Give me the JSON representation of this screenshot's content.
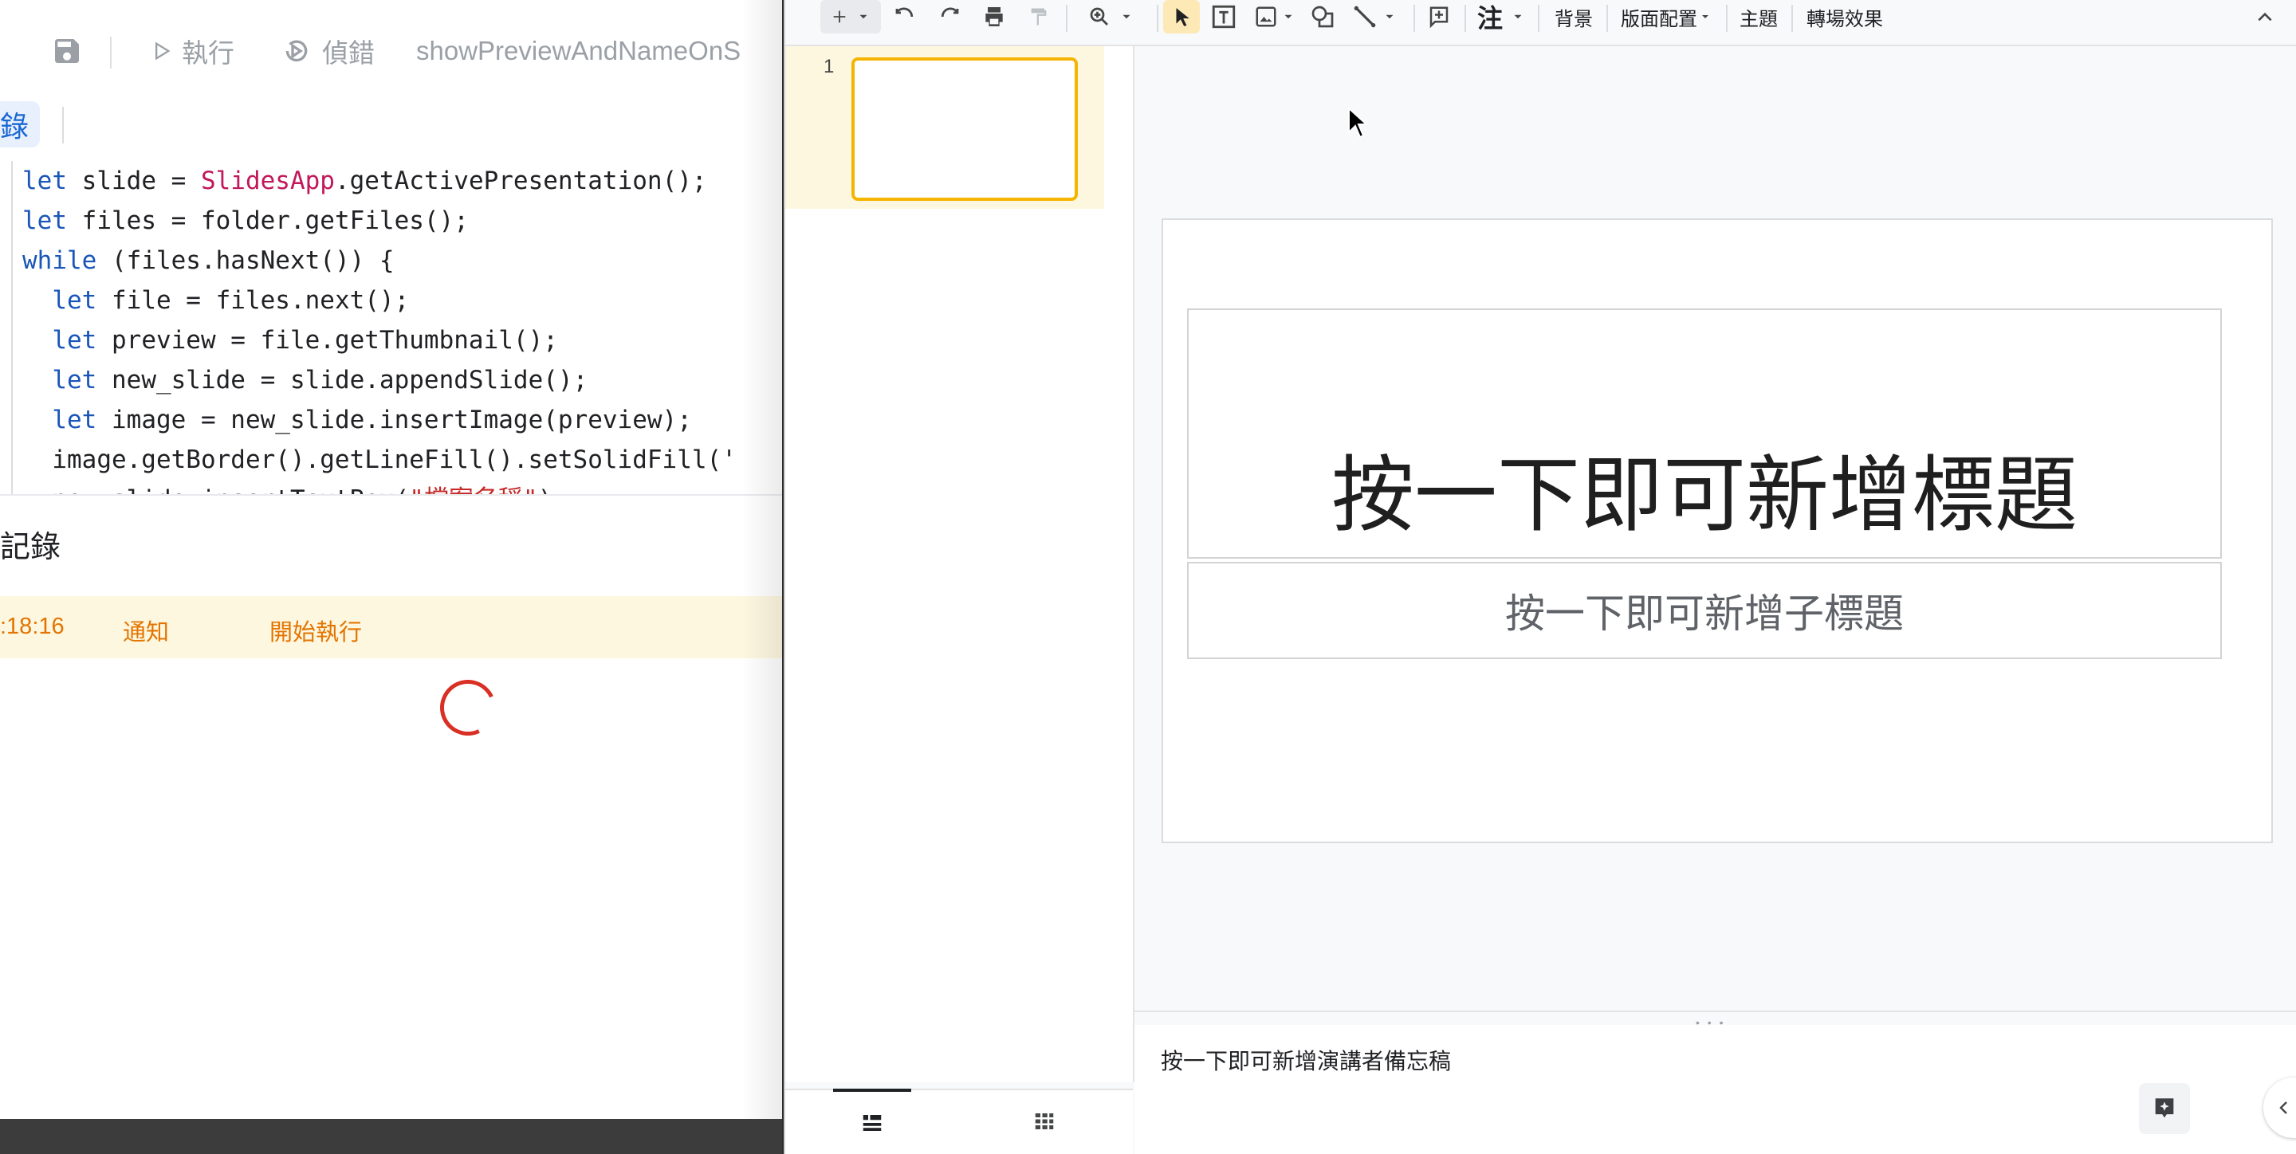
{
  "script_editor": {
    "toolbar": {
      "run_label": "執行",
      "debug_label": "偵錯",
      "function_name": "showPreviewAndNameOnS"
    },
    "tabs": {
      "logs_chip_label": "錄"
    },
    "code_lines": [
      [
        {
          "t": "let",
          "c": "kw"
        },
        {
          "t": " slide = "
        },
        {
          "t": "SlidesApp",
          "c": "cls"
        },
        {
          "t": ".getActivePresentation();"
        }
      ],
      [
        {
          "t": "let",
          "c": "kw"
        },
        {
          "t": " files = folder.getFiles();"
        }
      ],
      [
        {
          "t": "while",
          "c": "kw"
        },
        {
          "t": " (files.hasNext()) {"
        }
      ],
      [
        {
          "t": "  "
        },
        {
          "t": "let",
          "c": "kw"
        },
        {
          "t": " file = files.next();"
        }
      ],
      [
        {
          "t": "  "
        },
        {
          "t": "let",
          "c": "kw"
        },
        {
          "t": " preview = file.getThumbnail();"
        }
      ],
      [
        {
          "t": "  "
        },
        {
          "t": "let",
          "c": "kw"
        },
        {
          "t": " new_slide = slide.appendSlide();"
        }
      ],
      [
        {
          "t": "  "
        },
        {
          "t": "let",
          "c": "kw"
        },
        {
          "t": " image = new_slide.insertImage(preview);"
        }
      ],
      [
        {
          "t": "  image.getBorder().getLineFill().setSolidFill('"
        }
      ],
      [
        {
          "t": "  new_slide.insertTextBox("
        },
        {
          "t": "\"檔案名稱\"",
          "c": "str"
        },
        {
          "t": ");"
        }
      ]
    ],
    "execution_log": {
      "title": "記錄",
      "rows": [
        {
          "time": ":18:16",
          "level": "通知",
          "message": "開始執行"
        }
      ]
    }
  },
  "slides_app": {
    "toolbar": {
      "background_label": "背景",
      "layout_label": "版面配置",
      "theme_label": "主題",
      "transition_label": "轉場效果",
      "comment_label": "注"
    },
    "filmstrip": {
      "slides": [
        {
          "number": "1"
        }
      ]
    },
    "slide": {
      "title_placeholder": "按一下即可新增標題",
      "subtitle_placeholder": "按一下即可新增子標題"
    },
    "speaker_notes_placeholder": "按一下即可新增演講者備忘稿",
    "colors": {
      "selected_slide_border": "#f4b400",
      "selected_slide_row": "#fef7e0",
      "select_tool_active": "#fde9b6"
    }
  }
}
